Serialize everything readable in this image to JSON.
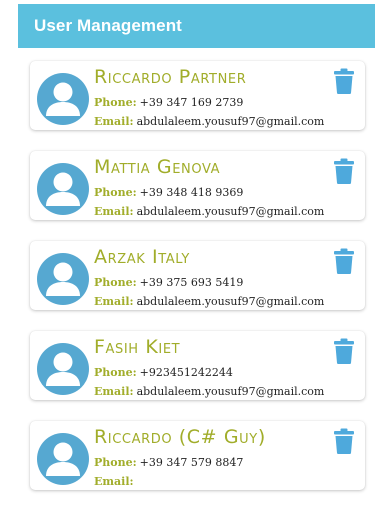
{
  "header": {
    "title": "User Management"
  },
  "colors": {
    "accent": "#5bc0de",
    "avatar": "#56a8d1",
    "name": "#a1ad2a",
    "trash": "#4ea9dc"
  },
  "users": [
    {
      "name": "Riccardo Partner",
      "phone_label": "Phone:",
      "phone": "+39 347 169 2739",
      "email_label": "Email:",
      "email": "abdulaleem.yousuf97@gmail.com",
      "avatar_icon": "user-icon",
      "delete_icon": "trash-icon"
    },
    {
      "name": "Mattia Genova",
      "phone_label": "Phone:",
      "phone": "+39 348 418 9369",
      "email_label": "Email:",
      "email": "abdulaleem.yousuf97@gmail.com",
      "avatar_icon": "user-icon",
      "delete_icon": "trash-icon"
    },
    {
      "name": "Arzak Italy",
      "phone_label": "Phone:",
      "phone": "+39 375 693 5419",
      "email_label": "Email:",
      "email": "abdulaleem.yousuf97@gmail.com",
      "avatar_icon": "user-icon",
      "delete_icon": "trash-icon"
    },
    {
      "name": "Fasih Kiet",
      "phone_label": "Phone:",
      "phone": "+923451242244",
      "email_label": "Email:",
      "email": "abdulaleem.yousuf97@gmail.com",
      "avatar_icon": "user-icon",
      "delete_icon": "trash-icon"
    },
    {
      "name": "Riccardo (C# Guy)",
      "phone_label": "Phone:",
      "phone": "+39 347 579 8847",
      "email_label": "Email:",
      "email": "",
      "avatar_icon": "user-icon",
      "delete_icon": "trash-icon"
    }
  ]
}
